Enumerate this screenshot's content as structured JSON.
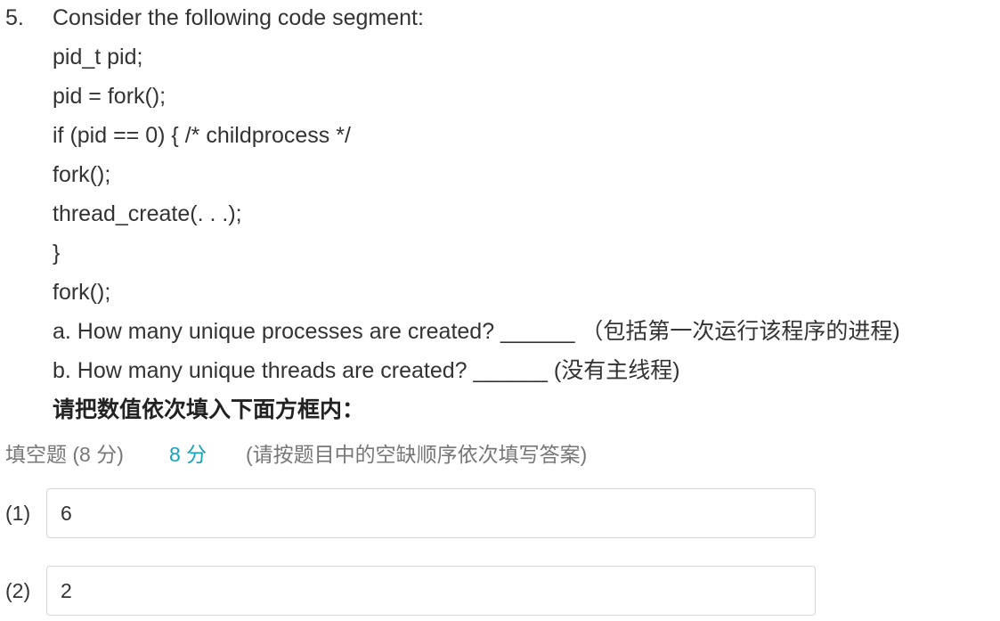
{
  "question": {
    "number": "5.",
    "lines": [
      "Consider the following code segment:",
      "pid_t pid;",
      "pid = fork();",
      "if (pid == 0) { /* childprocess */",
      "fork();",
      "thread_create(. . .);",
      "}",
      "fork();",
      "a. How many unique processes are created? ______ （包括第一次运行该程序的进程)",
      "b. How many unique threads are created? ______ (没有主线程)",
      "请把数值依次填入下面方框内："
    ]
  },
  "meta": {
    "type": "填空题 (8 分)",
    "score": "8 分",
    "hint": "(请按题目中的空缺顺序依次填写答案)"
  },
  "answers": [
    {
      "index": "(1)",
      "value": "6"
    },
    {
      "index": "(2)",
      "value": "2"
    }
  ]
}
